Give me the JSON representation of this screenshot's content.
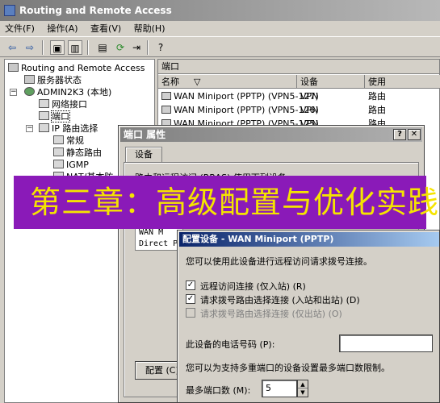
{
  "window": {
    "title": "Routing and Remote Access"
  },
  "menu": [
    "文件(F)",
    "操作(A)",
    "查看(V)",
    "帮助(H)"
  ],
  "toolbar": {
    "icons": [
      "back-arrow-icon",
      "forward-arrow-icon",
      "up-folder-icon",
      "show-tree-icon",
      "properties-icon",
      "refresh-icon",
      "export-icon",
      "help-icon"
    ]
  },
  "tree": {
    "root": "Routing and Remote Access",
    "server_status": "服务器状态",
    "server": "ADMIN2K3 (本地)",
    "network_interfaces": "网络接口",
    "ports": "端口",
    "ip_routing": "IP 路由选择",
    "general": "常规",
    "static_routes": "静态路由",
    "igmp": "IGMP",
    "nat": "NAT/基本防"
  },
  "list": {
    "title": "端口",
    "columns": [
      "名称",
      "设备",
      "使用"
    ],
    "rows": [
      {
        "name": "WAN Miniport (PPTP) (VPN5-127)",
        "device": "VPN",
        "use": "路由"
      },
      {
        "name": "WAN Miniport (PPTP) (VPN5-126)",
        "device": "VPN",
        "use": "路由"
      },
      {
        "name": "WAN Miniport (PPTP) (VPN5-125)",
        "device": "VPN",
        "use": "路由"
      }
    ]
  },
  "ports_dialog": {
    "title": "端口 属性",
    "tab": "设备",
    "desc": "路由和远程访问 (RRAS) 使用下列设备",
    "list_item_1": "WAN M",
    "list_item_2": "Direct P",
    "configure_button": "配置 (C)"
  },
  "configure_dialog": {
    "title": "配置设备 - WAN Miniport (PPTP)",
    "intro": "您可以使用此设备进行远程访问请求拨号连接。",
    "checkbox_inbound": "远程访问连接 (仅入站) (R)",
    "checkbox_demand": "请求拨号路由选择连接 (入站和出站) (D)",
    "checkbox_outbound": "请求拨号路由选择连接 (仅出站) (O)",
    "phone_label": "此设备的电话号码 (P):",
    "phone_value": "",
    "limit_note": "您可以为支持多重端口的设备设置最多端口数限制。",
    "max_ports_label": "最多端口数 (M):",
    "max_ports_value": "5"
  },
  "banner": {
    "text": "第三章：高级配置与优化实践"
  },
  "colors": {
    "banner_bg": "#8a1ab8",
    "banner_text": "#f5e400",
    "active_title": "#0a246a"
  }
}
